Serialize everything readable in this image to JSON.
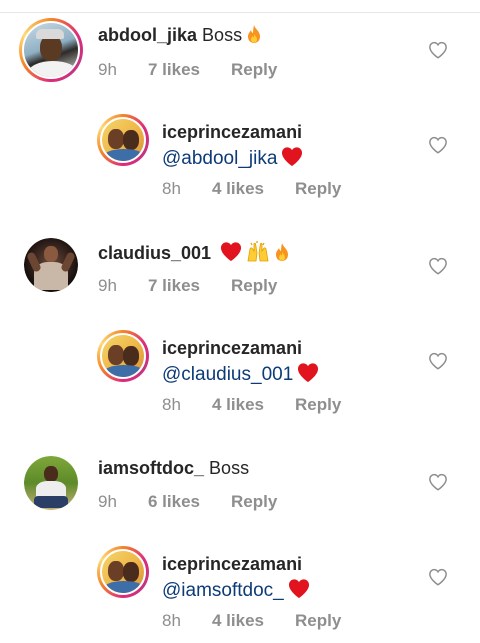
{
  "comments": [
    {
      "username": "abdool_jika",
      "text": "Boss",
      "emoji": [
        "fire"
      ],
      "time": "9h",
      "likes": "7 likes",
      "reply": "Reply",
      "is_reply": false
    },
    {
      "username": "iceprincezamani",
      "mention": "@abdool_jika",
      "emoji": [
        "heart"
      ],
      "time": "8h",
      "likes": "4 likes",
      "reply": "Reply",
      "is_reply": true
    },
    {
      "username": "claudius_001",
      "text": "",
      "emoji": [
        "heart",
        "raised-hands",
        "fire"
      ],
      "time": "9h",
      "likes": "7 likes",
      "reply": "Reply",
      "is_reply": false
    },
    {
      "username": "iceprincezamani",
      "mention": "@claudius_001",
      "emoji": [
        "heart"
      ],
      "time": "8h",
      "likes": "4 likes",
      "reply": "Reply",
      "is_reply": true
    },
    {
      "username": "iamsoftdoc_",
      "text": "Boss",
      "emoji": [],
      "time": "9h",
      "likes": "6 likes",
      "reply": "Reply",
      "is_reply": false
    },
    {
      "username": "iceprincezamani",
      "mention": "@iamsoftdoc_",
      "emoji": [
        "heart"
      ],
      "time": "8h",
      "likes": "4 likes",
      "reply": "Reply",
      "is_reply": true
    }
  ],
  "colors": {
    "mention": "#0d3b78",
    "meta": "#8e8e8e",
    "heart_emoji": "#e0131f",
    "fire": "#f7931e",
    "story_ring": "#dd2a7b"
  }
}
